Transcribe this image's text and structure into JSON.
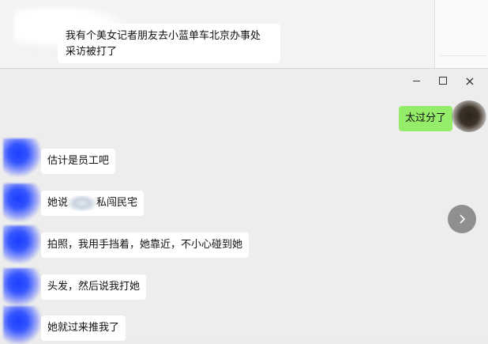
{
  "background_chat": {
    "message": "我有个美女记者朋友去小蓝单车北京办事处\n采访被打了"
  },
  "window_controls": {
    "minimize_icon": "minimize-icon",
    "maximize_icon": "maximize-icon",
    "close_label": "×"
  },
  "messages": [
    {
      "side": "right",
      "text": "太过分了"
    },
    {
      "side": "left",
      "text": "估计是员工吧"
    },
    {
      "side": "left",
      "text_before": "她说",
      "text_after": "私闯民宅"
    },
    {
      "side": "left",
      "text": "拍照，我用手挡着，她靠近，不小心碰到她"
    },
    {
      "side": "left",
      "text": "头发，然后说我打她"
    },
    {
      "side": "left",
      "text": "她就过来推我了"
    }
  ],
  "colors": {
    "sent_bubble": "#95ec69",
    "received_bubble": "#ffffff",
    "window_bg": "#ededed"
  },
  "icons": {
    "next": "chevron-right-icon"
  }
}
